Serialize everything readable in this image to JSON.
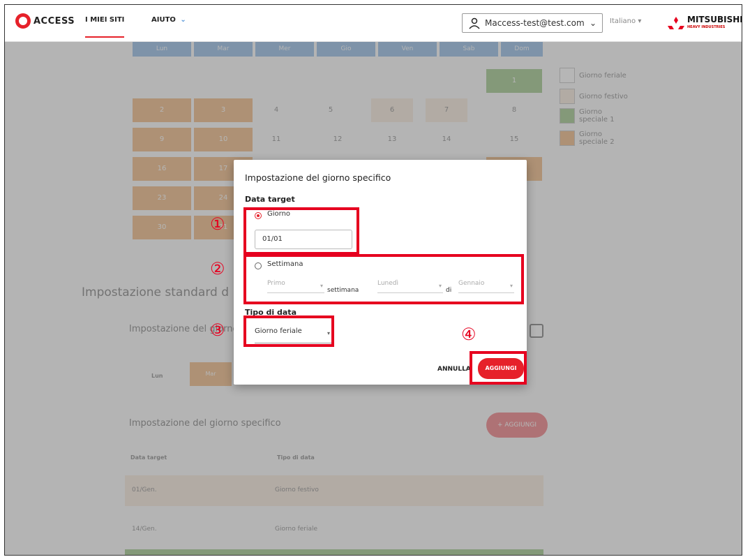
{
  "nav": {
    "logo_text": "ACCESS",
    "tabs": [
      {
        "label": "I MIEI SITI"
      },
      {
        "label": "AIUTO"
      }
    ],
    "user_email": "Maccess-test@test.com",
    "language": "Italiano",
    "brand_name": "MITSUBISHI",
    "brand_sub": "HEAVY INDUSTRIES"
  },
  "calendar": {
    "weekdays": [
      "Lun",
      "Mar",
      "Mer",
      "Gio",
      "Ven",
      "Sab",
      "Dom"
    ],
    "rows": [
      [
        "",
        "",
        "",
        "",
        "",
        "",
        "1"
      ],
      [
        "2",
        "3",
        "4",
        "5",
        "6",
        "7",
        "8"
      ],
      [
        "9",
        "10",
        "11",
        "12",
        "13",
        "14",
        "15"
      ],
      [
        "16",
        "17",
        "",
        "",
        "",
        "",
        ""
      ],
      [
        "23",
        "24",
        "",
        "",
        "",
        "",
        ""
      ],
      [
        "30",
        "31",
        "",
        "",
        "",
        "",
        ""
      ]
    ],
    "legend": [
      {
        "label": "Giorno feriale",
        "color": "#ffffff"
      },
      {
        "label": "Giorno festivo",
        "color": "#f3dcc6"
      },
      {
        "label": "Giorno speciale 1",
        "color": "#5ea038"
      },
      {
        "label": "Giorno speciale 2",
        "color": "#e58a2a"
      }
    ]
  },
  "bg": {
    "standard_heading": "Impostazione standard d",
    "standard_sub": "Impostazione del giorno",
    "weekly_days": [
      "Lun",
      "Mar"
    ],
    "specific_heading": "Impostazione del giorno specifico",
    "specific_add": "+ AGGIUNGI",
    "table_headers": [
      "Data target",
      "Tipo di data"
    ],
    "table_rows": [
      {
        "date": "01/Gen.",
        "type": "Giorno festivo"
      },
      {
        "date": "14/Gen.",
        "type": "Giorno feriale"
      }
    ]
  },
  "dialog": {
    "title": "Impostazione del giorno specifico",
    "target_label": "Data target",
    "day_option": "Giorno",
    "day_value": "01/01",
    "week_option": "Settimana",
    "week_ordinal": "Primo",
    "week_word": "settimana",
    "week_day": "Lunedì",
    "of_word": "di",
    "month": "Gennaio",
    "type_label": "Tipo di data",
    "type_value": "Giorno feriale",
    "cancel": "ANNULLA",
    "add": "AGGIUNGI"
  },
  "annotations": [
    "①",
    "②",
    "③",
    "④"
  ]
}
